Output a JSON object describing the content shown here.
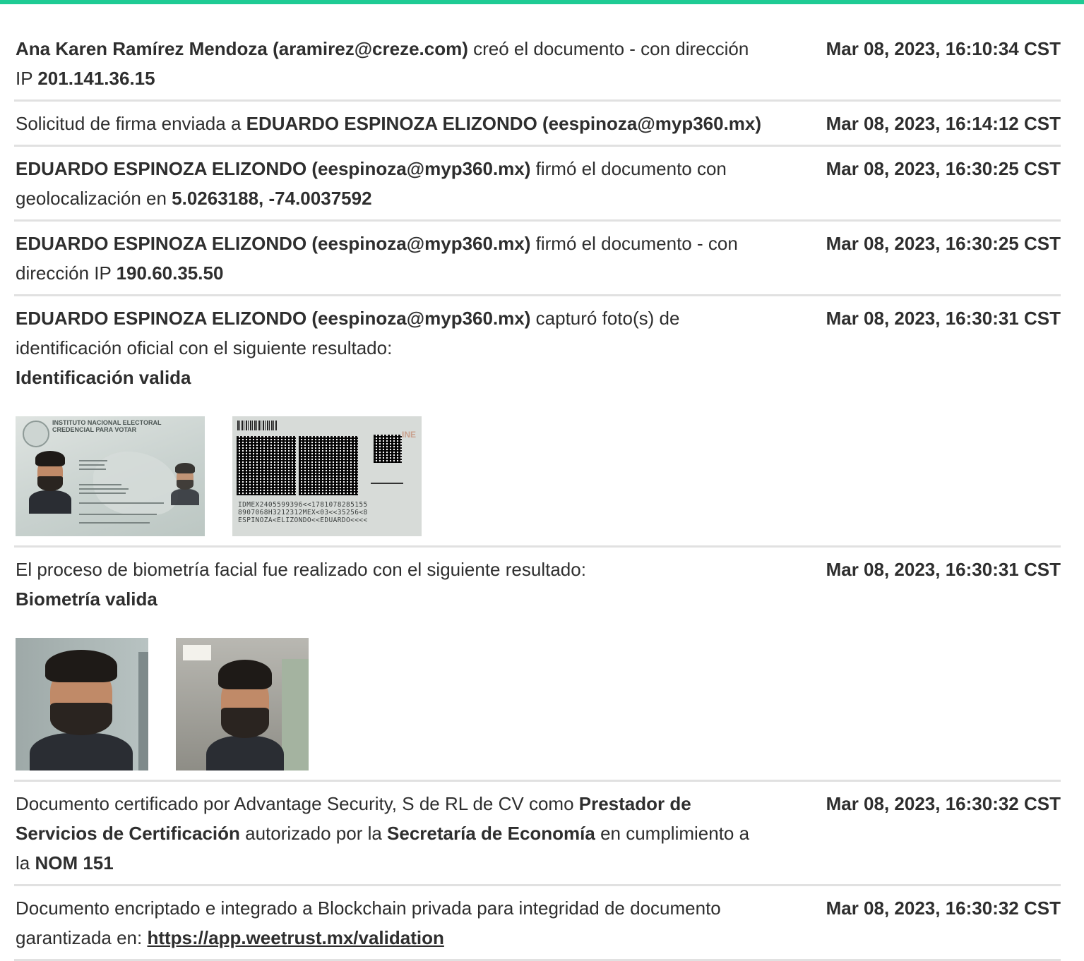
{
  "theme": {
    "accent": "#1ecb94",
    "divider": "#e1e1e1",
    "text": "#2e2e2e"
  },
  "entries": [
    {
      "time": "Mar 08, 2023, 16:10:34 CST",
      "parts": [
        {
          "t": "Ana Karen Ramírez Mendoza (aramirez@creze.com)",
          "b": true
        },
        {
          "t": " creó el documento - con dirección IP "
        },
        {
          "t": "201.141.36.15",
          "b": true
        }
      ]
    },
    {
      "time": "Mar 08, 2023, 16:14:12 CST",
      "parts": [
        {
          "t": "Solicitud de firma enviada a "
        },
        {
          "t": "EDUARDO ESPINOZA ELIZONDO (eespinoza@myp360.mx)",
          "b": true
        }
      ]
    },
    {
      "time": "Mar 08, 2023, 16:30:25 CST",
      "parts": [
        {
          "t": "EDUARDO ESPINOZA ELIZONDO (eespinoza@myp360.mx)",
          "b": true
        },
        {
          "t": " firmó el documento con geolocalización en "
        },
        {
          "t": "5.0263188, -74.0037592",
          "b": true
        }
      ]
    },
    {
      "time": "Mar 08, 2023, 16:30:25 CST",
      "parts": [
        {
          "t": "EDUARDO ESPINOZA ELIZONDO (eespinoza@myp360.mx)",
          "b": true
        },
        {
          "t": " firmó el documento - con dirección IP "
        },
        {
          "t": "190.60.35.50",
          "b": true
        }
      ]
    },
    {
      "time": "Mar 08, 2023, 16:30:31 CST",
      "parts": [
        {
          "t": "EDUARDO ESPINOZA ELIZONDO (eespinoza@myp360.mx)",
          "b": true
        },
        {
          "t": " capturó foto(s) de identificación oficial con el siguiente resultado:"
        },
        {
          "br": true
        },
        {
          "t": "Identificación valida",
          "b": true
        }
      ],
      "photos": "id"
    },
    {
      "time": "Mar 08, 2023, 16:30:31 CST",
      "parts": [
        {
          "t": "El proceso de biometría facial fue realizado con el siguiente resultado:"
        },
        {
          "br": true
        },
        {
          "t": "Biometría valida",
          "b": true
        }
      ],
      "photos": "bio"
    },
    {
      "time": "Mar 08, 2023, 16:30:32 CST",
      "parts": [
        {
          "t": "Documento certificado por Advantage Security, S de RL de CV como "
        },
        {
          "t": "Prestador de Servicios de Certificación",
          "b": true
        },
        {
          "t": " autorizado por la "
        },
        {
          "t": "Secretaría de Economía",
          "b": true
        },
        {
          "t": " en cumplimiento a la "
        },
        {
          "t": "NOM 151",
          "b": true
        }
      ]
    },
    {
      "time": "Mar 08, 2023, 16:30:32 CST",
      "parts": [
        {
          "t": "Documento encriptado e integrado a Blockchain privada para integridad de documento garantizada en: "
        },
        {
          "t": "https://app.weetrust.mx/validation",
          "link": true
        }
      ]
    }
  ],
  "id_card": {
    "front_header": "INSTITUTO NACIONAL ELECTORAL\nCREDENCIAL PARA VOTAR",
    "back_brand": "INE",
    "mrz": [
      "IDMEX2405599396<<1781078285155",
      "8907068H3212312MEX<03<<35256<8",
      "ESPINOZA<ELIZONDO<<EDUARDO<<<<"
    ]
  }
}
